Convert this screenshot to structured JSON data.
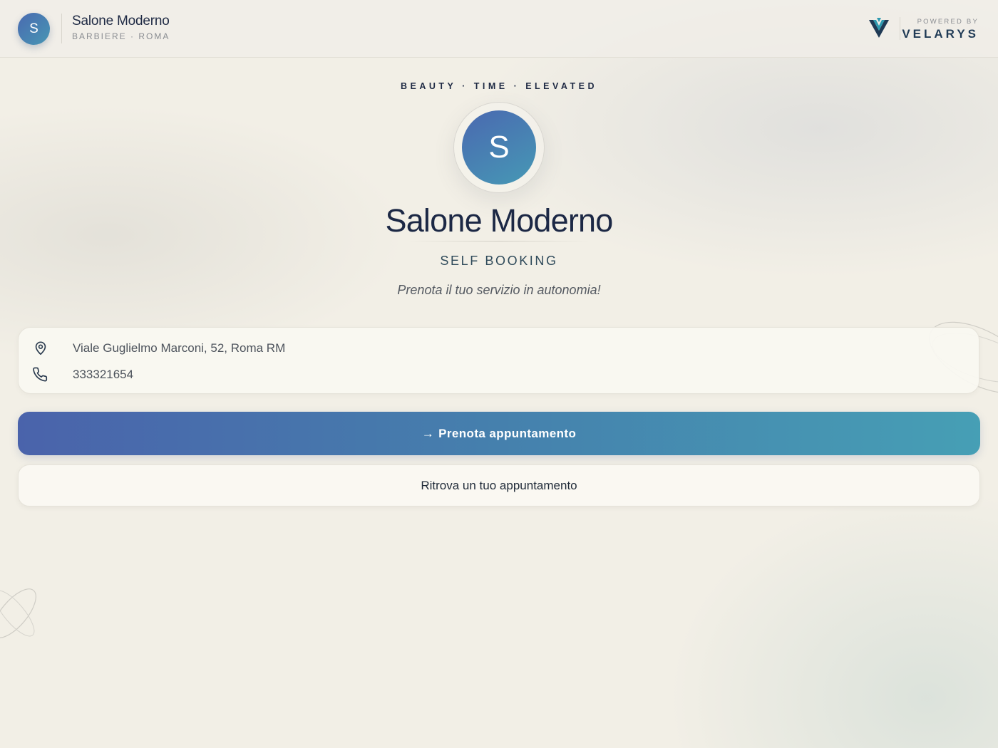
{
  "header": {
    "avatar_letter": "S",
    "salon_name": "Salone Moderno",
    "subtitle": "BARBIERE · ROMA",
    "powered_by": "POWERED BY",
    "brand_name": "VELARYS"
  },
  "hero": {
    "tagline": "BEAUTY · TIME · ELEVATED",
    "avatar_letter": "S",
    "title": "Salone Moderno",
    "subtitle": "SELF BOOKING",
    "description": "Prenota il tuo servizio in autonomia!"
  },
  "info": {
    "address": "Viale Guglielmo Marconi, 52, Roma RM",
    "phone": "333321654"
  },
  "actions": {
    "book_arrow": "→",
    "book_label": "Prenota appuntamento",
    "find_label": "Ritrova un tuo appuntamento"
  },
  "icons": {
    "brand": "velarys-logo-icon",
    "address": "map-pin-icon",
    "phone": "phone-icon",
    "book": "arrow-right-icon"
  },
  "colors": {
    "background": "#f2efe6",
    "text_primary": "#1c2845",
    "accent_start": "#4a63ab",
    "accent_end": "#469fb5",
    "card": "#faf8f2"
  }
}
